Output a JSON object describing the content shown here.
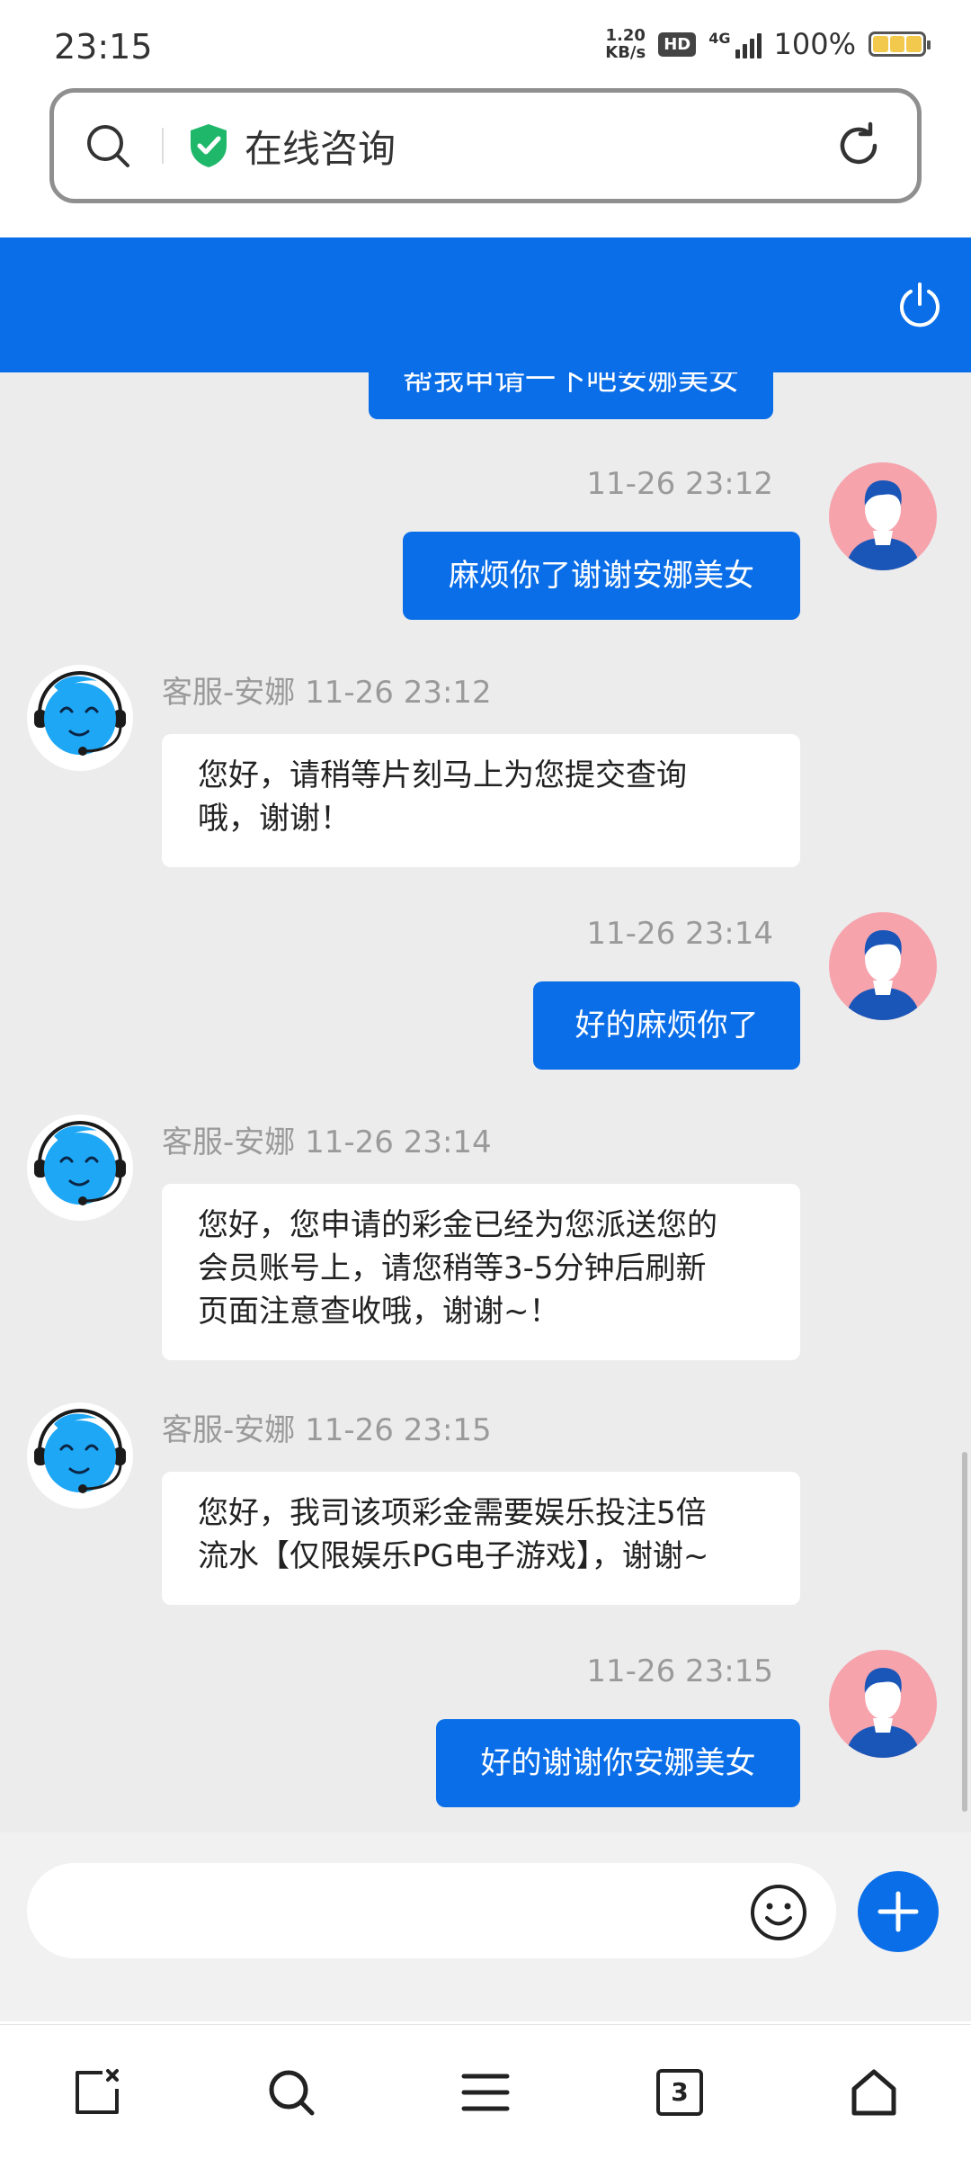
{
  "status_bar": {
    "time": "23:15",
    "speed_value": "1.20",
    "speed_unit": "KB/s",
    "hd": "HD",
    "network": "4G",
    "battery": "100%"
  },
  "address_bar": {
    "title": "在线咨询"
  },
  "chat": {
    "partial_message": "帮我申请一下吧安娜美女",
    "messages": [
      {
        "sender": "user",
        "time": "11-26 23:12",
        "text": "麻烦你了谢谢安娜美女"
      },
      {
        "sender": "agent",
        "name": "客服-安娜",
        "time": "11-26 23:12",
        "text": "您好，请稍等片刻马上为您提交查询\n哦，谢谢！"
      },
      {
        "sender": "user",
        "time": "11-26 23:14",
        "text": "好的麻烦你了"
      },
      {
        "sender": "agent",
        "name": "客服-安娜",
        "time": "11-26 23:14",
        "text": "您好，您申请的彩金已经为您派送您的\n会员账号上，请您稍等3-5分钟后刷新\n页面注意查收哦，谢谢~！"
      },
      {
        "sender": "agent",
        "name": "客服-安娜",
        "time": "11-26 23:15",
        "text": "您好，我司该项彩金需要娱乐投注5倍\n流水【仅限娱乐PG电子游戏】，谢谢~"
      },
      {
        "sender": "user",
        "time": "11-26 23:15",
        "text": "好的谢谢你安娜美女"
      }
    ]
  },
  "input": {
    "placeholder": ""
  },
  "bottom_nav": {
    "tab_count": "3"
  },
  "colors": {
    "accent": "#0a6ee8",
    "chat_background": "#ececec",
    "user_avatar_bg": "#f6a3ac",
    "agent_avatar": "#1ea7f5"
  }
}
